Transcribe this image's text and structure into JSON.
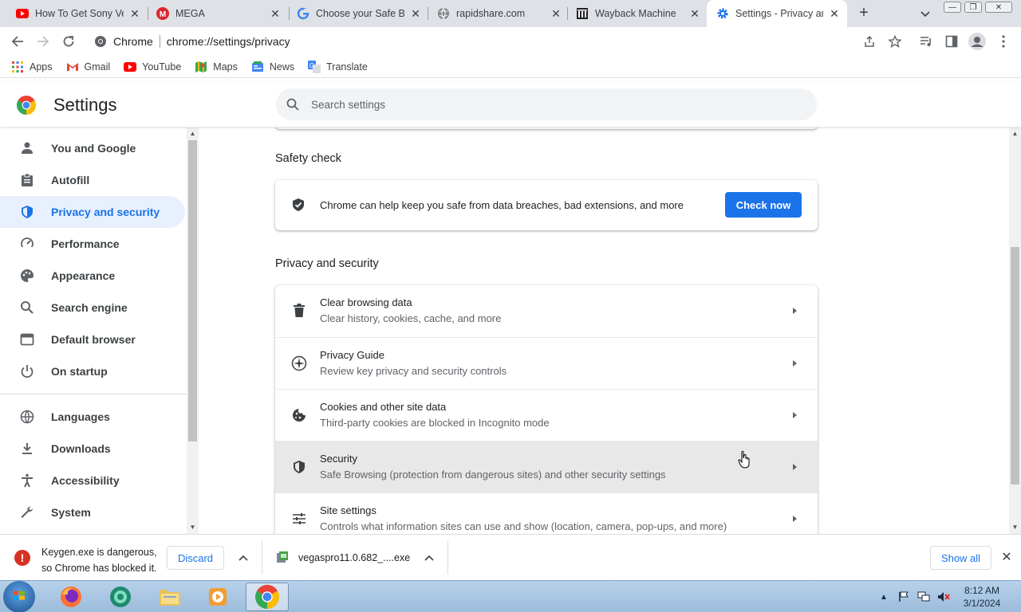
{
  "tabs": [
    {
      "title": "How To Get Sony Ve",
      "icon": "youtube-icon"
    },
    {
      "title": "MEGA",
      "icon": "mega-icon"
    },
    {
      "title": "Choose your Safe Br",
      "icon": "google-icon"
    },
    {
      "title": "rapidshare.com",
      "icon": "globe-icon"
    },
    {
      "title": "Wayback Machine",
      "icon": "wayback-icon"
    },
    {
      "title": "Settings - Privacy an",
      "icon": "gear-icon",
      "active": true
    }
  ],
  "omnibox": {
    "site": "Chrome",
    "url": "chrome://settings/privacy"
  },
  "bookmarks": [
    {
      "label": "Apps",
      "icon": "apps-grid-icon"
    },
    {
      "label": "Gmail",
      "icon": "gmail-icon"
    },
    {
      "label": "YouTube",
      "icon": "youtube-icon"
    },
    {
      "label": "Maps",
      "icon": "maps-icon"
    },
    {
      "label": "News",
      "icon": "news-icon"
    },
    {
      "label": "Translate",
      "icon": "translate-icon"
    }
  ],
  "settings": {
    "title": "Settings",
    "search_placeholder": "Search settings"
  },
  "sidebar": {
    "items": [
      {
        "label": "You and Google",
        "icon": "person-icon"
      },
      {
        "label": "Autofill",
        "icon": "clipboard-icon"
      },
      {
        "label": "Privacy and security",
        "icon": "shield-icon",
        "selected": true
      },
      {
        "label": "Performance",
        "icon": "speedometer-icon"
      },
      {
        "label": "Appearance",
        "icon": "palette-icon"
      },
      {
        "label": "Search engine",
        "icon": "search-icon"
      },
      {
        "label": "Default browser",
        "icon": "browser-icon"
      },
      {
        "label": "On startup",
        "icon": "power-icon"
      },
      {
        "label": "Languages",
        "icon": "globe-icon"
      },
      {
        "label": "Downloads",
        "icon": "download-icon"
      },
      {
        "label": "Accessibility",
        "icon": "accessibility-icon"
      },
      {
        "label": "System",
        "icon": "wrench-icon"
      }
    ]
  },
  "safety_check": {
    "heading": "Safety check",
    "text": "Chrome can help keep you safe from data breaches, bad extensions, and more",
    "button": "Check now"
  },
  "privacy": {
    "heading": "Privacy and security",
    "rows": [
      {
        "title": "Clear browsing data",
        "subtitle": "Clear history, cookies, cache, and more",
        "icon": "trash-icon"
      },
      {
        "title": "Privacy Guide",
        "subtitle": "Review key privacy and security controls",
        "icon": "compass-icon"
      },
      {
        "title": "Cookies and other site data",
        "subtitle": "Third-party cookies are blocked in Incognito mode",
        "icon": "cookie-icon"
      },
      {
        "title": "Security",
        "subtitle": "Safe Browsing (protection from dangerous sites) and other security settings",
        "icon": "shield-icon",
        "hover": true
      },
      {
        "title": "Site settings",
        "subtitle": "Controls what information sites can use and show (location, camera, pop-ups, and more)",
        "icon": "sliders-icon"
      }
    ]
  },
  "downloads": {
    "warning_line1": "Keygen.exe is dangerous,",
    "warning_line2": "so Chrome has blocked it.",
    "discard": "Discard",
    "file": "vegaspro11.0.682_....exe",
    "show_all": "Show all"
  },
  "taskbar": {
    "time": "8:12 AM",
    "date": "3/1/2024"
  },
  "colors": {
    "accent": "#1a73e8",
    "selected_bg": "#e8f0fe",
    "danger": "#d93025"
  }
}
